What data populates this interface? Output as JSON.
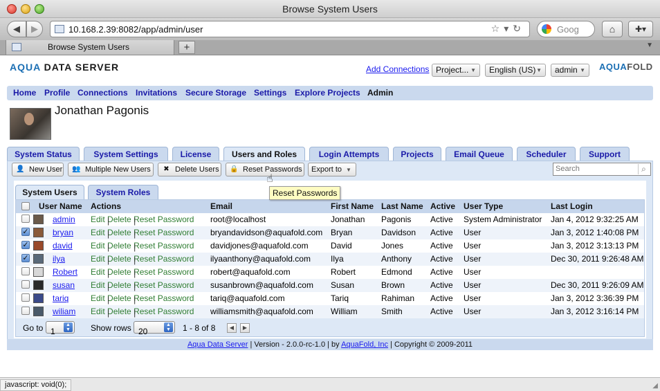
{
  "window": {
    "title": "Browse System Users"
  },
  "browser": {
    "url": "10.168.2.39:8082/app/admin/user",
    "search_placeholder": "Goog",
    "tab_title": "Browse System Users",
    "status_text": "javascript: void(0);"
  },
  "header": {
    "brand_prefix": "AQUA",
    "brand_suffix": "DATA SERVER",
    "brand_right_a": "AQUA",
    "brand_right_b": "FOLD",
    "add_connections": "Add Connections",
    "project_select": "Project...",
    "language_select": "English (US)",
    "user_select": "admin"
  },
  "menu": [
    "Home",
    "Profile",
    "Connections",
    "Invitations",
    "Secure Storage",
    "Settings",
    "Explore Projects",
    "Admin"
  ],
  "profile": {
    "name": "Jonathan Pagonis"
  },
  "tabs": [
    "System Status",
    "System Settings",
    "License",
    "Users and Roles",
    "Login Attempts",
    "Projects",
    "Email Queue",
    "Scheduler",
    "Support"
  ],
  "toolbar": {
    "new_user": "New User",
    "multiple_new_users": "Multiple New Users",
    "delete_users": "Delete Users",
    "reset_passwords": "Reset Passwords",
    "export_to": "Export to",
    "search_placeholder": "Search",
    "tooltip": "Reset Passwords"
  },
  "subtabs": [
    "System Users",
    "System Roles"
  ],
  "table": {
    "headers": [
      "User Name",
      "Actions",
      "Email",
      "First Name",
      "Last Name",
      "Active",
      "User Type",
      "Last Login"
    ],
    "action_edit": "Edit",
    "action_delete": "Delete",
    "action_reset": "Reset Password",
    "action_sep": "|",
    "rows": [
      {
        "user": "admin",
        "email": "root@localhost",
        "first": "Jonathan",
        "last": "Pagonis",
        "active": "Active",
        "type": "System Administrator",
        "login": "Jan 4, 2012 9:32:25 AM",
        "checked": false,
        "thumb": "#6b5a4a"
      },
      {
        "user": "bryan",
        "email": "bryandavidson@aquafold.com",
        "first": "Bryan",
        "last": "Davidson",
        "active": "Active",
        "type": "User",
        "login": "Jan 3, 2012 1:40:08 PM",
        "checked": true,
        "thumb": "#8a5a3a"
      },
      {
        "user": "david",
        "email": "davidjones@aquafold.com",
        "first": "David",
        "last": "Jones",
        "active": "Active",
        "type": "User",
        "login": "Jan 3, 2012 3:13:13 PM",
        "checked": true,
        "thumb": "#9a4a2a"
      },
      {
        "user": "ilya",
        "email": "ilyaanthony@aquafold.com",
        "first": "Ilya",
        "last": "Anthony",
        "active": "Active",
        "type": "User",
        "login": "Dec 30, 2011 9:26:48 AM",
        "checked": true,
        "thumb": "#5a6a7a"
      },
      {
        "user": "Robert",
        "email": "robert@aquafold.com",
        "first": "Robert",
        "last": "Edmond",
        "active": "Active",
        "type": "User",
        "login": "",
        "checked": false,
        "thumb": "#d8d8d8"
      },
      {
        "user": "susan",
        "email": "susanbrown@aquafold.com",
        "first": "Susan",
        "last": "Brown",
        "active": "Active",
        "type": "User",
        "login": "Dec 30, 2011 9:26:09 AM",
        "checked": false,
        "thumb": "#2a2a2a"
      },
      {
        "user": "tariq",
        "email": "tariq@aquafold.com",
        "first": "Tariq",
        "last": "Rahiman",
        "active": "Active",
        "type": "User",
        "login": "Jan 3, 2012 3:36:39 PM",
        "checked": false,
        "thumb": "#3a4a8a"
      },
      {
        "user": "wiliam",
        "email": "williamsmith@aquafold.com",
        "first": "William",
        "last": "Smith",
        "active": "Active",
        "type": "User",
        "login": "Jan 3, 2012 3:16:14 PM",
        "checked": false,
        "thumb": "#4a5a6a"
      }
    ]
  },
  "pager": {
    "goto_label": "Go to",
    "goto_value": "1",
    "show_rows_label": "Show rows",
    "show_rows_value": "20",
    "range": "1 - 8 of 8"
  },
  "footer": {
    "product": "Aqua Data Server",
    "version": " | Version - 2.0.0-rc-1.0 | by ",
    "company": "AquaFold, Inc",
    "copyright": " | Copyright © 2009-2011"
  }
}
